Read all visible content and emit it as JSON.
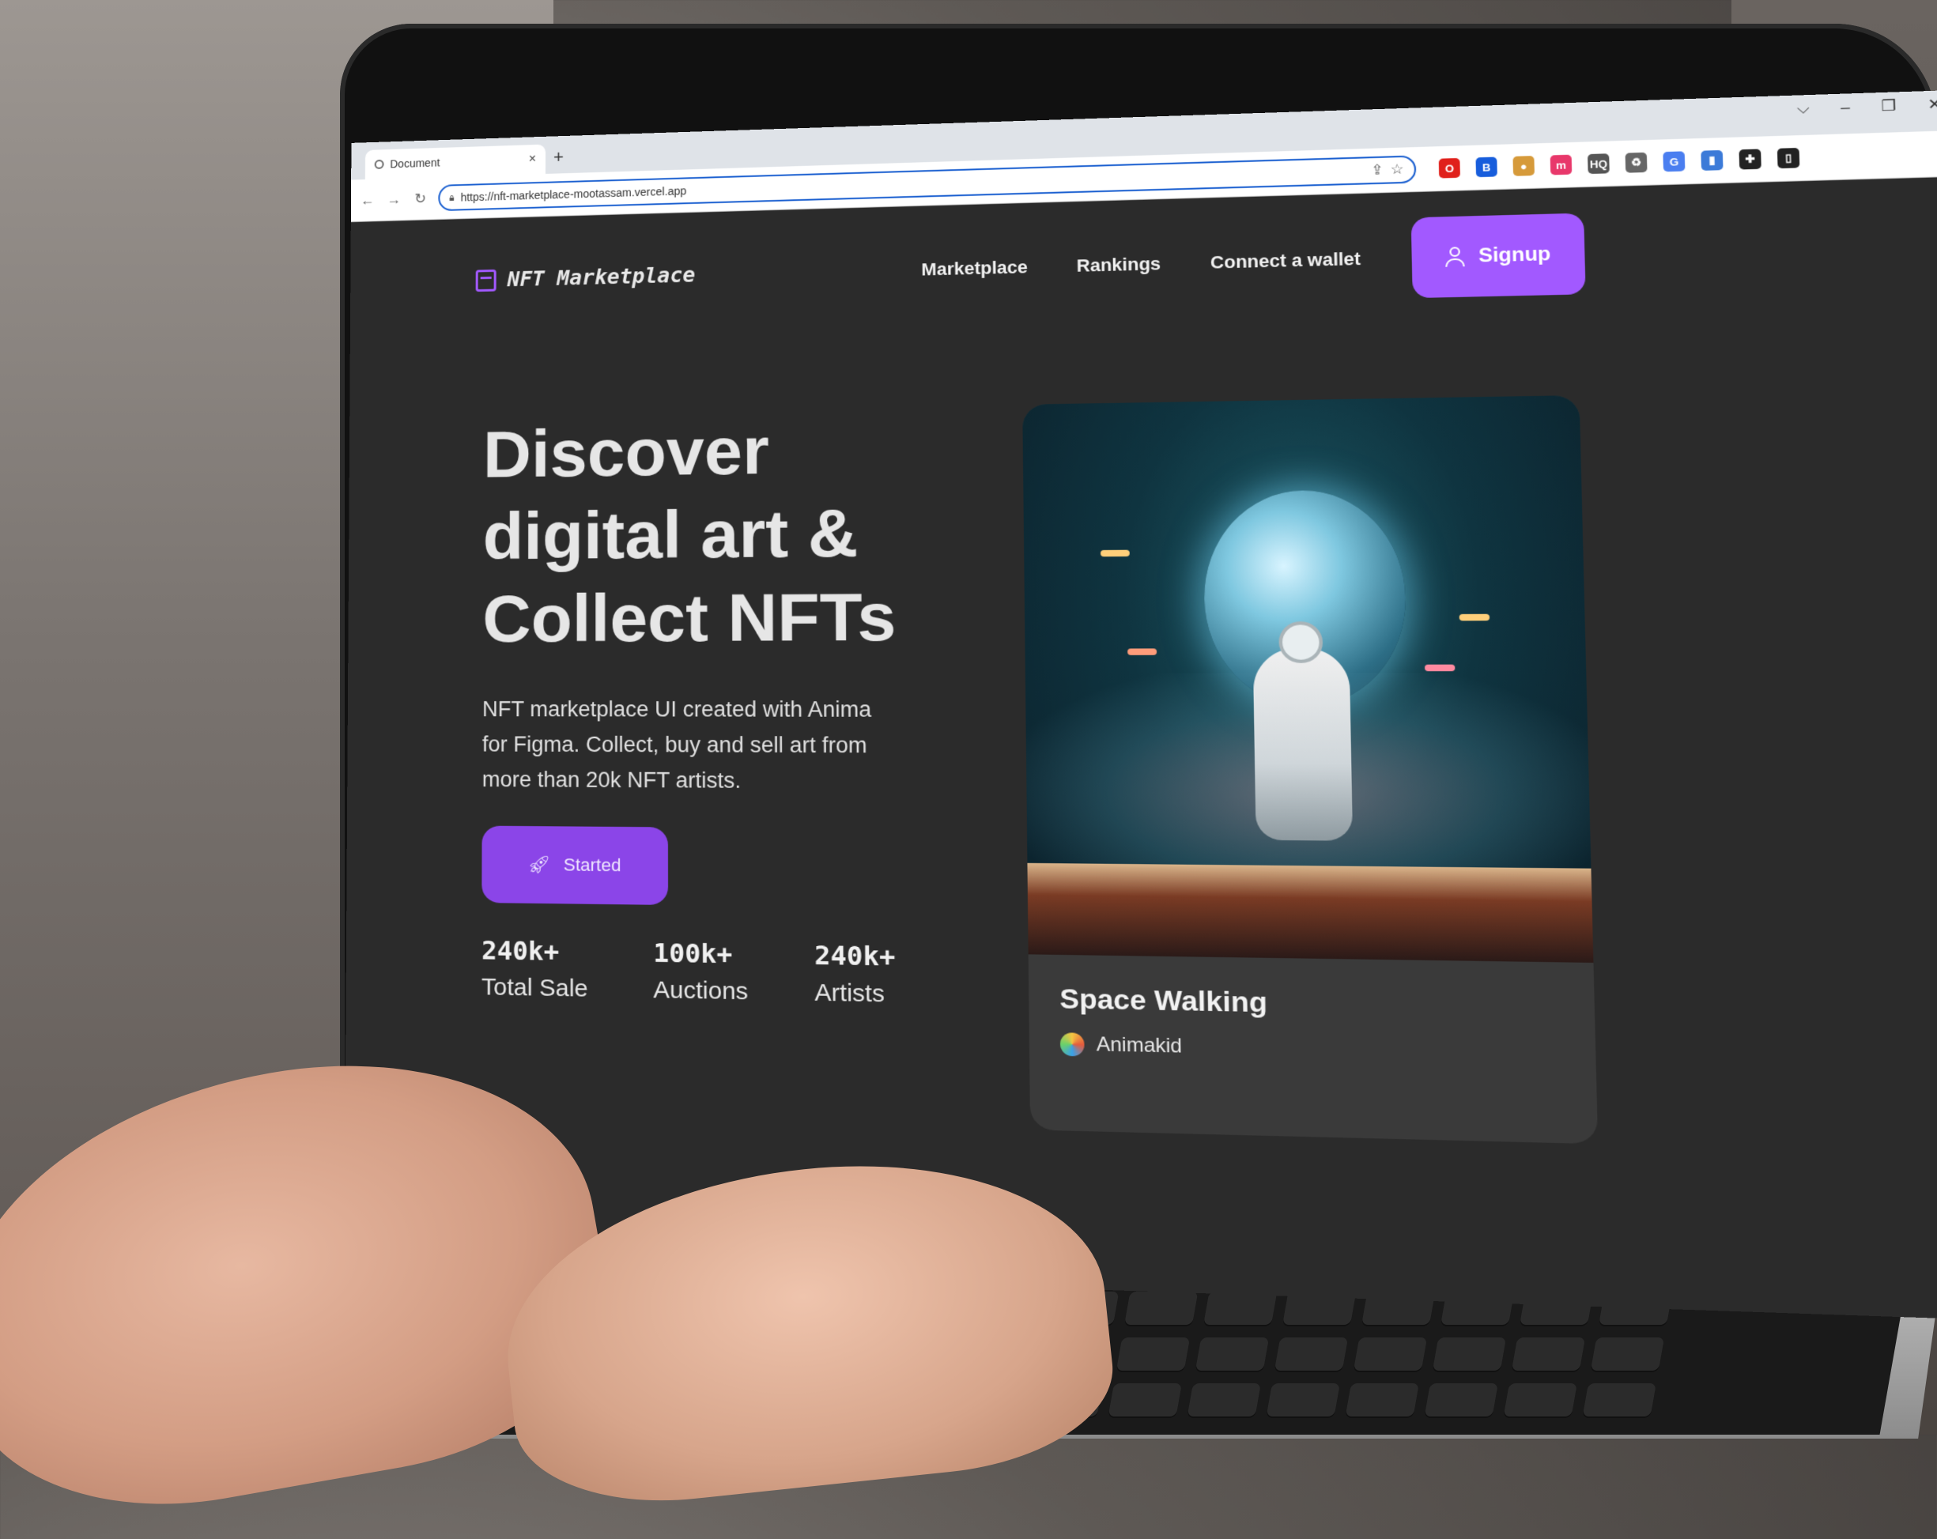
{
  "browser": {
    "tab_title": "Document",
    "tab_close": "×",
    "new_tab": "+",
    "url": "https://nft-marketplace-mootassam.vercel.app",
    "window_controls": [
      "⌵",
      "–",
      "❐",
      "✕"
    ],
    "nav": {
      "back": "←",
      "forward": "→",
      "reload": "↻"
    },
    "extensions": [
      {
        "icon": "opera-icon",
        "color": "#e0201b",
        "glyph": "O"
      },
      {
        "icon": "bitwarden-icon",
        "color": "#175ddc",
        "glyph": "B"
      },
      {
        "icon": "cookie-icon",
        "color": "#d69a3a",
        "glyph": "●"
      },
      {
        "icon": "extension-m-icon",
        "color": "#e8386b",
        "glyph": "m"
      },
      {
        "icon": "used-hq-icon",
        "color": "#555555",
        "glyph": "HQ"
      },
      {
        "icon": "recycle-icon",
        "color": "#666666",
        "glyph": "♻"
      },
      {
        "icon": "translate-icon",
        "color": "#4a7ef0",
        "glyph": "G"
      },
      {
        "icon": "doc-icon",
        "color": "#3b7ad8",
        "glyph": "▮"
      },
      {
        "icon": "puzzle-icon",
        "color": "#222222",
        "glyph": "✚"
      },
      {
        "icon": "sidepanel-icon",
        "color": "#222222",
        "glyph": "▯"
      }
    ]
  },
  "site": {
    "brand": "NFT Marketplace",
    "nav_links": [
      "Marketplace",
      "Rankings",
      "Connect a wallet"
    ],
    "signup": "Signup",
    "accent": "#a259ff",
    "hero": {
      "title_lines": [
        "Discover",
        "digital art &",
        "Collect NFTs"
      ],
      "subtitle": "NFT marketplace UI created with Anima for Figma. Collect, buy and sell art from more than 20k NFT artists.",
      "cta": "Started"
    },
    "stats": [
      {
        "value": "240k+",
        "label": "Total Sale"
      },
      {
        "value": "100k+",
        "label": "Auctions"
      },
      {
        "value": "240k+",
        "label": "Artists"
      }
    ],
    "featured": {
      "title": "Space Walking",
      "artist": "Animakid"
    }
  }
}
